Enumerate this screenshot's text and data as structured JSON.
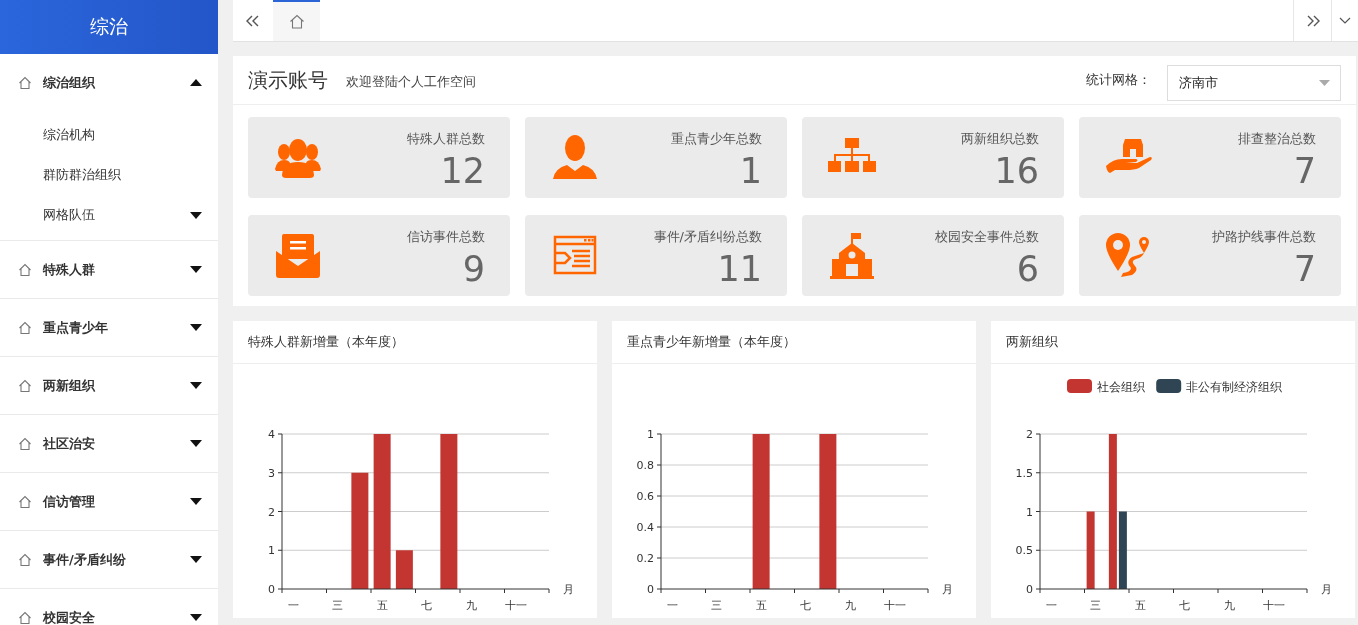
{
  "sidebar": {
    "title": "综治",
    "groups": [
      {
        "label": "综治组织",
        "expanded": true,
        "children": [
          {
            "label": "综治机构",
            "kind": "leaf"
          },
          {
            "label": "群防群治组织",
            "kind": "leaf"
          },
          {
            "label": "网格队伍",
            "kind": "folder"
          }
        ]
      },
      {
        "label": "特殊人群",
        "expanded": false
      },
      {
        "label": "重点青少年",
        "expanded": false
      },
      {
        "label": "两新组织",
        "expanded": false
      },
      {
        "label": "社区治安",
        "expanded": false
      },
      {
        "label": "信访管理",
        "expanded": false
      },
      {
        "label": "事件/矛盾纠纷",
        "expanded": false
      },
      {
        "label": "校园安全",
        "expanded": false
      }
    ]
  },
  "tabs": [
    {
      "kind": "home",
      "selected": true
    }
  ],
  "header": {
    "title": "演示账号",
    "welcome": "欢迎登陆个人工作空间",
    "grid_label": "统计网格：",
    "grid_select": {
      "value": "济南市"
    }
  },
  "stats": [
    {
      "kind": "people",
      "label": "特殊人群总数",
      "value": "12"
    },
    {
      "kind": "person",
      "label": "重点青少年总数",
      "value": "1"
    },
    {
      "kind": "org",
      "label": "两新组织总数",
      "value": "16"
    },
    {
      "kind": "hand-house",
      "label": "排查整治总数",
      "value": "7"
    },
    {
      "kind": "envelope",
      "label": "信访事件总数",
      "value": "9"
    },
    {
      "kind": "window",
      "label": "事件/矛盾纠纷总数",
      "value": "11"
    },
    {
      "kind": "school",
      "label": "校园安全事件总数",
      "value": "6"
    },
    {
      "kind": "route",
      "label": "护路护线事件总数",
      "value": "7"
    }
  ],
  "charts": [
    {
      "title": "特殊人群新增量（本年度）",
      "chart_data": {
        "type": "bar",
        "xlabel": "月",
        "categories": [
          "一",
          null,
          "三",
          null,
          "五",
          null,
          "七",
          null,
          "九",
          null,
          "十一",
          null
        ],
        "series": [
          {
            "color": "#c23531",
            "values": [
              0,
              0,
              0,
              3,
              4,
              1,
              0,
              4,
              0,
              0,
              0,
              0
            ]
          }
        ],
        "yticks": [
          0,
          1,
          2,
          3,
          4
        ],
        "ylim": [
          0,
          4
        ],
        "grid": true
      }
    },
    {
      "title": "重点青少年新增量（本年度）",
      "chart_data": {
        "type": "bar",
        "xlabel": "月",
        "categories": [
          "一",
          null,
          "三",
          null,
          "五",
          null,
          "七",
          null,
          "九",
          null,
          "十一",
          null
        ],
        "series": [
          {
            "color": "#c23531",
            "values": [
              0,
              0,
              0,
              0,
              1,
              0,
              0,
              1,
              0,
              0,
              0,
              0
            ]
          }
        ],
        "yticks": [
          0,
          0.2,
          0.4,
          0.6,
          0.8,
          1
        ],
        "ylim": [
          0,
          1
        ],
        "grid": true
      }
    },
    {
      "title": "两新组织",
      "chart_data": {
        "type": "bar",
        "xlabel": "月",
        "categories": [
          "一",
          null,
          "三",
          null,
          "五",
          null,
          "七",
          null,
          "九",
          null,
          "十一",
          null
        ],
        "series": [
          {
            "name": "社会组织",
            "color": "#c23531",
            "values": [
              0,
              0,
              1,
              2,
              0,
              0,
              0,
              0,
              0,
              0,
              0,
              0
            ]
          },
          {
            "name": "非公有制经济组织",
            "color": "#2f4554",
            "values": [
              0,
              0,
              0,
              1,
              0,
              0,
              0,
              0,
              0,
              0,
              0,
              0
            ]
          }
        ],
        "yticks": [
          0,
          0.5,
          1,
          1.5,
          2
        ],
        "ylim": [
          0,
          2
        ],
        "grid": true,
        "legend": true
      }
    }
  ]
}
